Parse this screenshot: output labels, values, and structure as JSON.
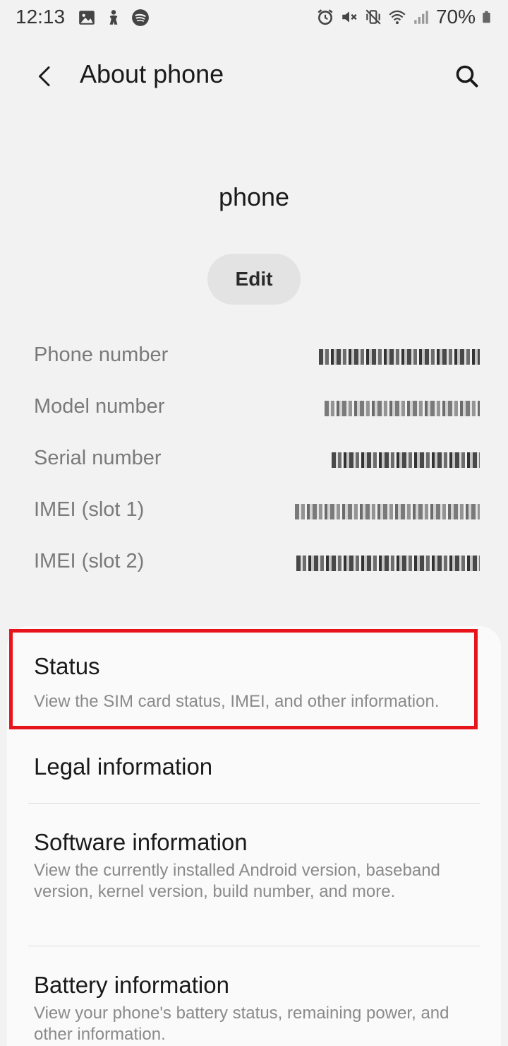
{
  "status_bar": {
    "time": "12:13",
    "left_icons": [
      "gallery-icon",
      "accessibility-icon",
      "spotify-icon"
    ],
    "right_icons": [
      "alarm-icon",
      "mute-icon",
      "vibrate-icon",
      "wifi-icon",
      "signal-icon"
    ],
    "battery_percent": "70%"
  },
  "header": {
    "title": "About phone"
  },
  "device": {
    "name": "phone",
    "edit_label": "Edit"
  },
  "info": {
    "rows": [
      {
        "label": "Phone number",
        "value": "redacted"
      },
      {
        "label": "Model number",
        "value": "redacted"
      },
      {
        "label": "Serial number",
        "value": "redacted"
      },
      {
        "label": "IMEI (slot 1)",
        "value": "redacted"
      },
      {
        "label": "IMEI (slot 2)",
        "value": "redacted"
      }
    ]
  },
  "menu": {
    "items": [
      {
        "title": "Status",
        "summary": "View the SIM card status, IMEI, and other information."
      },
      {
        "title": "Legal information",
        "summary": ""
      },
      {
        "title": "Software information",
        "summary": "View the currently installed Android version, baseband version, kernel version, build number, and more."
      },
      {
        "title": "Battery information",
        "summary": "View your phone's battery status, remaining power, and other information."
      }
    ]
  },
  "colors": {
    "background": "#f2f2f2",
    "card": "#fafafa",
    "highlight": "#e8141c",
    "secondary_text": "#8a8a8a"
  }
}
